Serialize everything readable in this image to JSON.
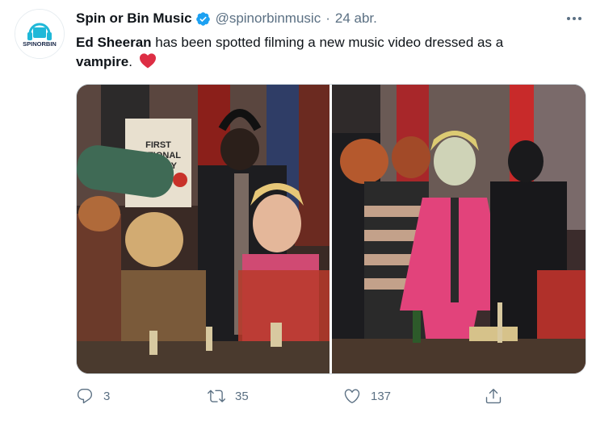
{
  "tweet": {
    "author": {
      "name": "Spin or Bin Music",
      "handle": "@spinorbinmusic",
      "separator": "·",
      "date": "24 abr.",
      "avatar_logo_text": "SPINORBIN",
      "verified": true
    },
    "text": {
      "part1_bold": "Ed Sheeran",
      "part2": " has been spotted filming a new music video dressed as a",
      "part3_bold": "vampire",
      "part4": ".",
      "emoji": "heart"
    },
    "media": [
      {
        "sign_text_1": "FIRST",
        "sign_text_2": "NATIONAL",
        "sign_text_3": "BAKERY"
      },
      {}
    ],
    "actions": {
      "reply_count": "3",
      "retweet_count": "35",
      "like_count": "137"
    }
  },
  "colors": {
    "text_primary": "#0f1419",
    "text_secondary": "#5b7083",
    "verified_blue": "#1da1f2",
    "heart_red": "#e0245e",
    "brand_teal": "#1fb8d8"
  },
  "icons": [
    "verified-badge-icon",
    "more-icon",
    "heart-emoji-icon",
    "reply-icon",
    "retweet-icon",
    "like-icon",
    "share-icon"
  ]
}
